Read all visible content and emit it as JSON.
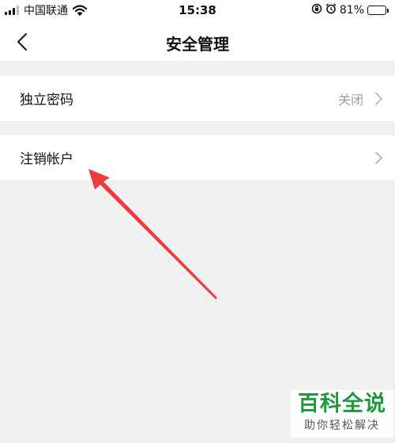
{
  "status_bar": {
    "carrier": "中国联通",
    "time": "15:38",
    "battery_percent": "81%",
    "battery_level": 0.81,
    "icons": [
      "signal-icon",
      "wifi-icon",
      "rotation-lock-icon",
      "alarm-icon",
      "battery-icon"
    ]
  },
  "nav": {
    "title": "安全管理",
    "back_icon": "chevron-left-icon"
  },
  "settings": {
    "items": [
      {
        "label": "独立密码",
        "value": "关闭",
        "icon": "chevron-right-icon"
      },
      {
        "label": "注销帐户",
        "value": "",
        "icon": "chevron-right-icon"
      }
    ]
  },
  "annotation": {
    "type": "red-arrow",
    "color": "#ef3b3b",
    "points_to": "注销帐户"
  },
  "watermark": {
    "main": "百科全说",
    "sub": "助你轻松解决",
    "color": "#1f9a3a"
  }
}
